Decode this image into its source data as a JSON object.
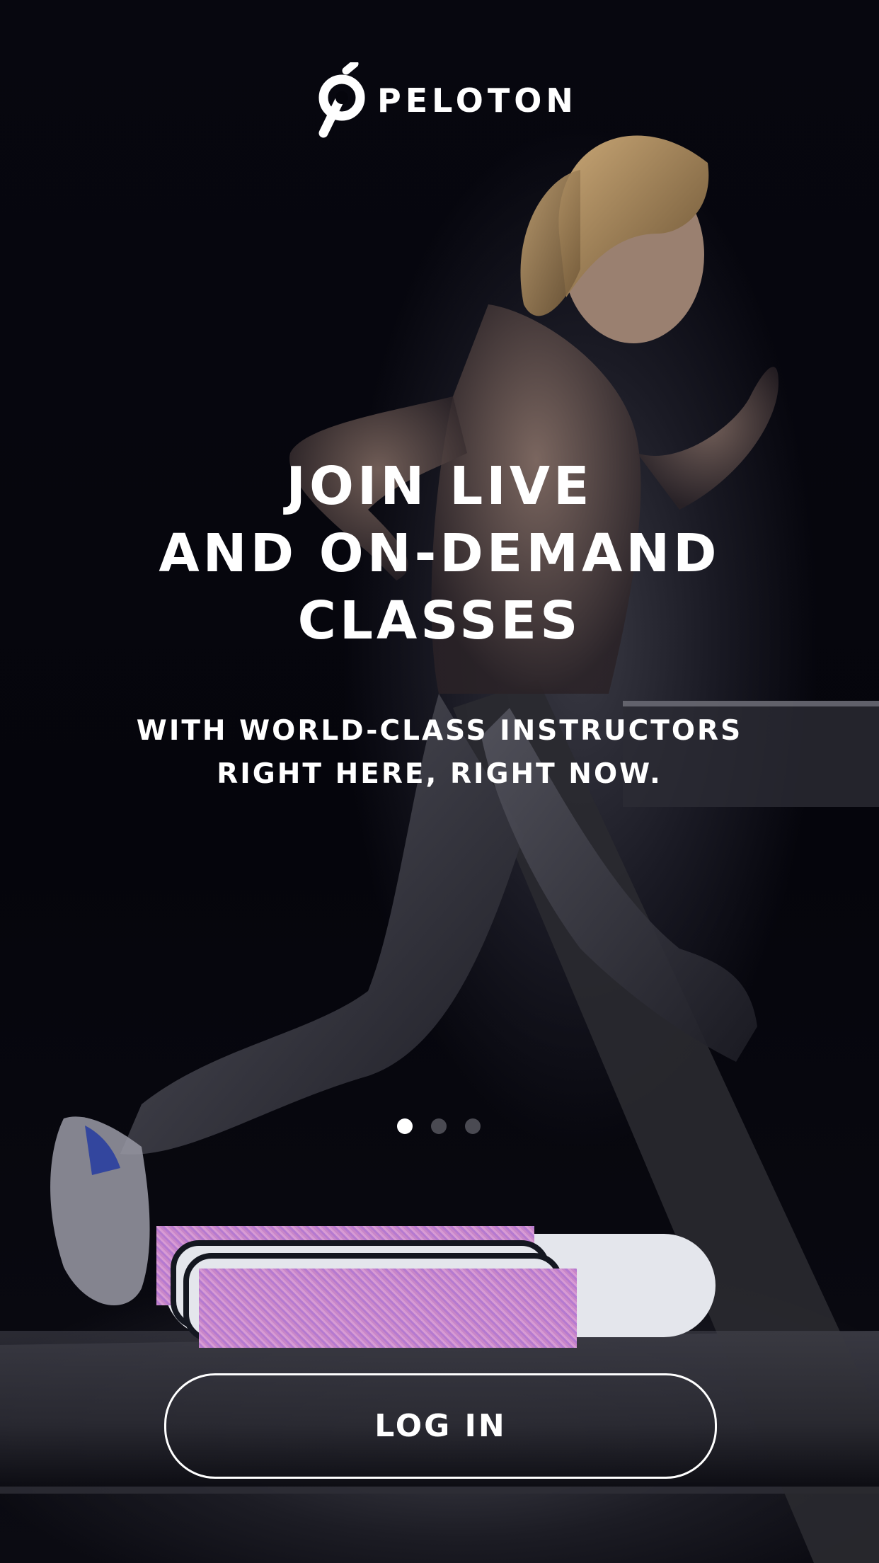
{
  "brand": {
    "logo_text": "PELOTON",
    "logo_icon": "peloton-logo-icon"
  },
  "hero": {
    "headline_lines": [
      "JOIN LIVE",
      "AND ON-DEMAND",
      "CLASSES"
    ],
    "subline_lines": [
      "WITH WORLD-CLASS INSTRUCTORS",
      "RIGHT HERE, RIGHT NOW."
    ]
  },
  "carousel": {
    "page_count": 3,
    "active_page": 1
  },
  "actions": {
    "login_label": "LOG IN"
  },
  "colors": {
    "background": "#05050c",
    "primary_button": "#e4e6ec",
    "text": "#ffffff",
    "dot_inactive": "#4a4a52"
  }
}
